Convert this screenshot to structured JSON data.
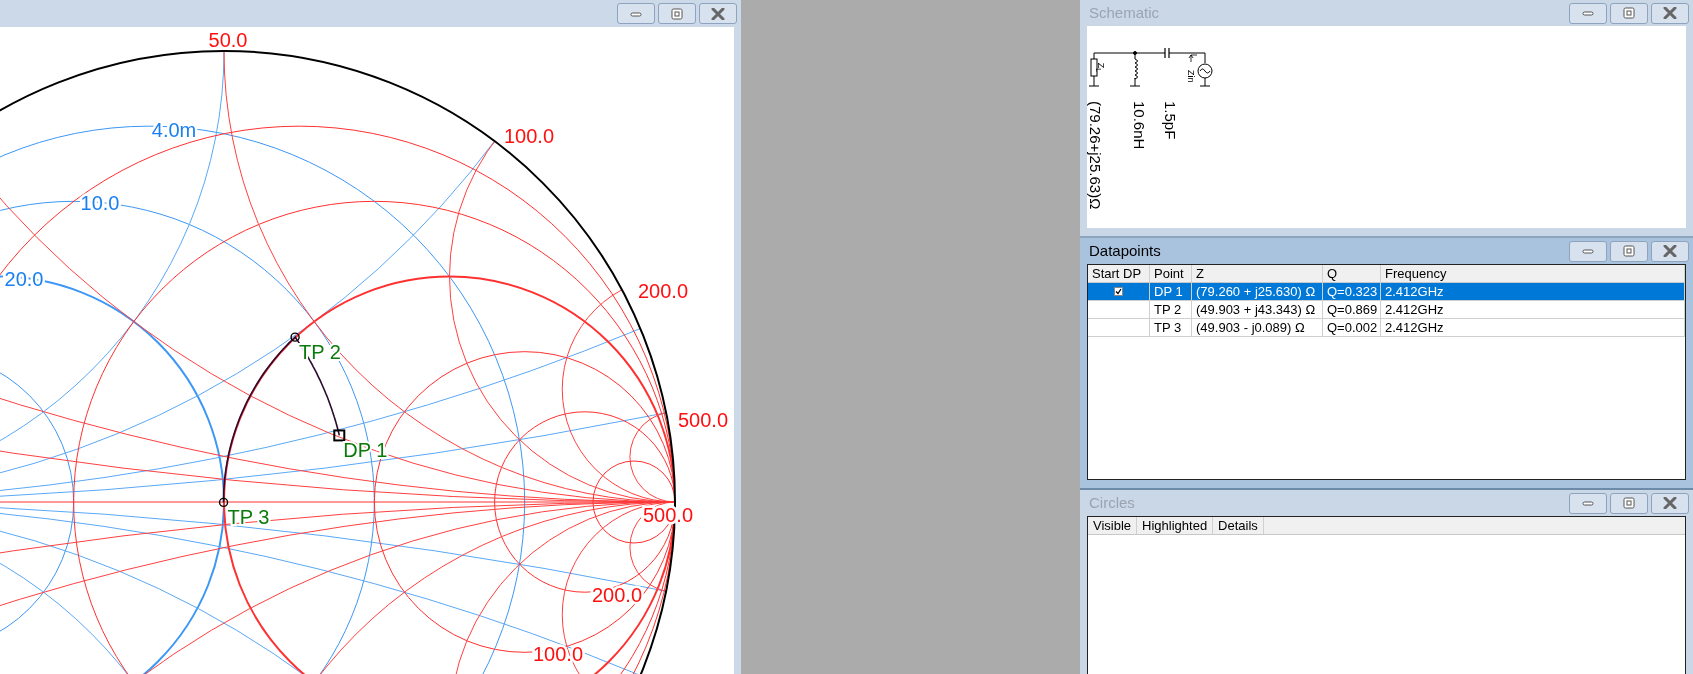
{
  "smith_chart_window": {
    "axis_labels": [
      {
        "text": "50.0",
        "kind": "reactance"
      },
      {
        "text": "100.0",
        "kind": "reactance"
      },
      {
        "text": "4.0m",
        "kind": "susceptance"
      },
      {
        "text": "10.0",
        "kind": "susceptance"
      },
      {
        "text": "200.0",
        "kind": "reactance"
      },
      {
        "text": "20.0",
        "kind": "susceptance"
      },
      {
        "text": "500.0",
        "kind": "reactance"
      },
      {
        "text": "500.0",
        "kind": "resistance"
      },
      {
        "text": "200.0",
        "kind": "resistance"
      },
      {
        "text": "100.0",
        "kind": "resistance"
      }
    ],
    "markers": [
      {
        "label": "TP 2",
        "kind": "transformed"
      },
      {
        "label": "DP 1",
        "kind": "start"
      },
      {
        "label": "TP 3",
        "kind": "transformed"
      }
    ]
  },
  "schematic": {
    "title": "Schematic",
    "active": false,
    "components": [
      {
        "kind": "load",
        "label": "Z$_{L}$",
        "value": "(79.26+j25.63)Ω"
      },
      {
        "kind": "inductor",
        "value": "10.6nH"
      },
      {
        "kind": "capacitor",
        "value": "1.5pF"
      },
      {
        "kind": "source",
        "label": "Zin"
      }
    ]
  },
  "datapoints": {
    "title": "Datapoints",
    "active": true,
    "columns": [
      "Start DP",
      "Point",
      "Z",
      "Q",
      "Frequency"
    ],
    "rows": [
      {
        "start_dp": true,
        "selected": true,
        "point": "DP 1",
        "z": "(79.260 + j25.630) Ω",
        "q": "Q=0.323",
        "frequency": "2.412GHz"
      },
      {
        "start_dp": false,
        "selected": false,
        "point": "TP 2",
        "z": "(49.903 + j43.343) Ω",
        "q": "Q=0.869",
        "frequency": "2.412GHz"
      },
      {
        "start_dp": false,
        "selected": false,
        "point": "TP 3",
        "z": "(49.903 - j0.089) Ω",
        "q": "Q=0.002",
        "frequency": "2.412GHz"
      }
    ]
  },
  "circles": {
    "title": "Circles",
    "active": false,
    "columns": [
      "Visible",
      "Highlighted",
      "Details"
    ]
  }
}
